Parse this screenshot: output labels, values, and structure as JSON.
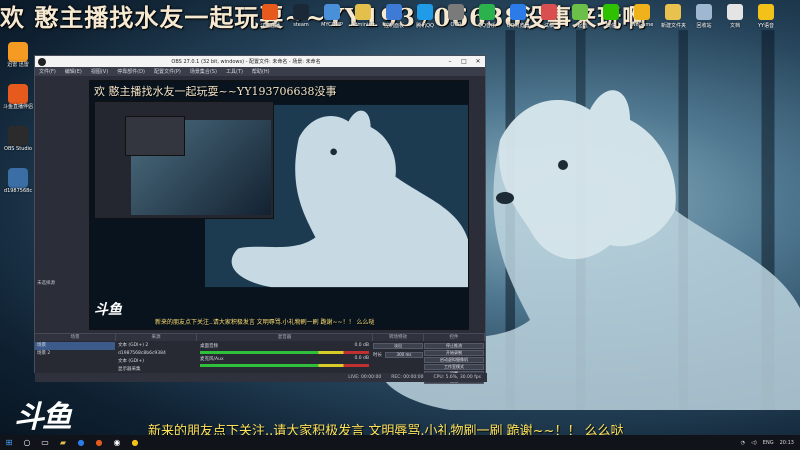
{
  "stream": {
    "top_banner": "欢 憨主播找水友一起玩耍~~YY193706638没事来玩啊",
    "bottom_message": "新来的朋友点下关注..请大家积极发言 文明辱骂.小礼物刷一刷 跪谢~~！！ 么么哒",
    "logo_text": "斗鱼"
  },
  "desktop_top_icons": [
    {
      "label": "斗鱼直播",
      "color": "#e65a1e",
      "icon": "app-icon"
    },
    {
      "label": "steam",
      "color": "#1b2838",
      "icon": "steam-icon"
    },
    {
      "label": "MYCOMP",
      "color": "#4a90d9",
      "icon": "computer-icon"
    },
    {
      "label": "Administr",
      "color": "#e3c04c",
      "icon": "folder-icon"
    },
    {
      "label": "控制面板",
      "color": "#3d7bd6",
      "icon": "control-panel-icon"
    },
    {
      "label": "腾讯QQ",
      "color": "#1f9be8",
      "icon": "qq-icon"
    },
    {
      "label": "OCR",
      "color": "#7a7a7a",
      "icon": "app-icon"
    },
    {
      "label": "QQ音乐",
      "color": "#2bb24c",
      "icon": "music-icon"
    },
    {
      "label": "QQ浏览器",
      "color": "#2b7be8",
      "icon": "browser-icon"
    },
    {
      "label": "试稿",
      "color": "#d94f4f",
      "icon": "app-icon"
    },
    {
      "label": "一起玩",
      "color": "#6cc04a",
      "icon": "app-icon"
    },
    {
      "label": "微信",
      "color": "#2dc100",
      "icon": "wechat-icon"
    },
    {
      "label": "WeGame",
      "color": "#f0b21a",
      "icon": "wegame-icon"
    },
    {
      "label": "新建文件夹",
      "color": "#e8c14e",
      "icon": "folder-icon"
    },
    {
      "label": "回收站",
      "color": "#9fb7d1",
      "icon": "recycle-bin-icon"
    },
    {
      "label": "文档",
      "color": "#e4e4e4",
      "icon": "document-icon"
    },
    {
      "label": "YY语音",
      "color": "#f2c21b",
      "icon": "yy-icon"
    }
  ],
  "desktop_left_icons": [
    {
      "label": "迅雷 迅雷",
      "color": "#f59a23",
      "icon": "thunder-icon"
    },
    {
      "label": "斗鱼直播伴侣",
      "color": "#e65a1e",
      "icon": "app-icon"
    },
    {
      "label": "OBS Studio",
      "color": "#2b2b2b",
      "icon": "obs-icon"
    },
    {
      "label": "d1987568c",
      "color": "#3a6ea5",
      "icon": "file-icon"
    }
  ],
  "obs": {
    "title": "OBS 27.0.1 (32 bit, windows) - 配置文件: 未命名 - 场景: 未命名",
    "menu": [
      "文件(F)",
      "编辑(E)",
      "视图(V)",
      "停靠部件(D)",
      "配置文件(P)",
      "场景集合(S)",
      "工具(T)",
      "帮助(H)"
    ],
    "preview_banner": "欢 憨主播找水友一起玩耍~~YY193706638没事",
    "preview_sub": "新来的朋友点下关注..请大家积极发言 文明辱骂.小礼物刷一刷 跪谢~~！！ 么么哒",
    "not_selected_label": "未选择源",
    "dock_headers": [
      "场景",
      "来源",
      "混音器",
      "转场特效",
      "控件"
    ],
    "scenes": [
      "场景",
      "场景 2"
    ],
    "sources": [
      "文本 (GDI+) 2",
      "d1987568c8b6c9384",
      "文本 (GDI+)",
      "显示器采集"
    ],
    "mixer": [
      {
        "name": "桌面音频",
        "db": "0.0 dB"
      },
      {
        "name": "麦克风/Aux",
        "db": "0.0 dB"
      }
    ],
    "transition": {
      "type": "淡出",
      "duration_label": "时长",
      "duration": "300 ms"
    },
    "controls": [
      "停止推流",
      "开始录制",
      "启动虚拟摄像机",
      "工作室模式",
      "设置",
      "退出"
    ],
    "status": [
      "LIVE: 00:00:00",
      "REC: 00:00:00",
      "CPU: 5.6%, 30.00 fps"
    ]
  },
  "taskbar": {
    "tray_lang": "ENG",
    "clock": "20:13"
  }
}
